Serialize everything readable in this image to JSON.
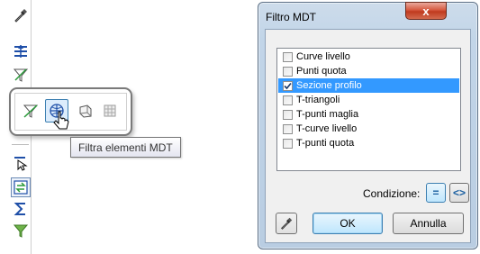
{
  "toolbar": {
    "icons": [
      "eyedropper-icon",
      "layers-icon",
      "filter-funnel-icon",
      "triangle-icon",
      "cursor-arrow-icon",
      "transfer-icon",
      "sigma-icon",
      "green-funnel-icon"
    ]
  },
  "flyout": {
    "icons": [
      "filter-line-icon",
      "filter-elements-icon",
      "filter-surface-icon",
      "filter-grid-icon"
    ],
    "tooltip": "Filtra elementi MDT"
  },
  "dialog": {
    "title": "Filtro MDT",
    "close_label": "x",
    "items": [
      {
        "label": "Curve livello",
        "checked": false
      },
      {
        "label": "Punti quota",
        "checked": false
      },
      {
        "label": "Sezione profilo",
        "checked": true
      },
      {
        "label": "T-triangoli",
        "checked": false
      },
      {
        "label": "T-punti maglia",
        "checked": false
      },
      {
        "label": "T-curve livello",
        "checked": false
      },
      {
        "label": "T-punti quota",
        "checked": false
      }
    ],
    "condition_label": "Condizione:",
    "condition_eq": "=",
    "condition_ne": "<>",
    "ok_label": "OK",
    "cancel_label": "Annulla"
  },
  "colors": {
    "selection": "#3399ff",
    "accent": "#3c7fb1"
  }
}
